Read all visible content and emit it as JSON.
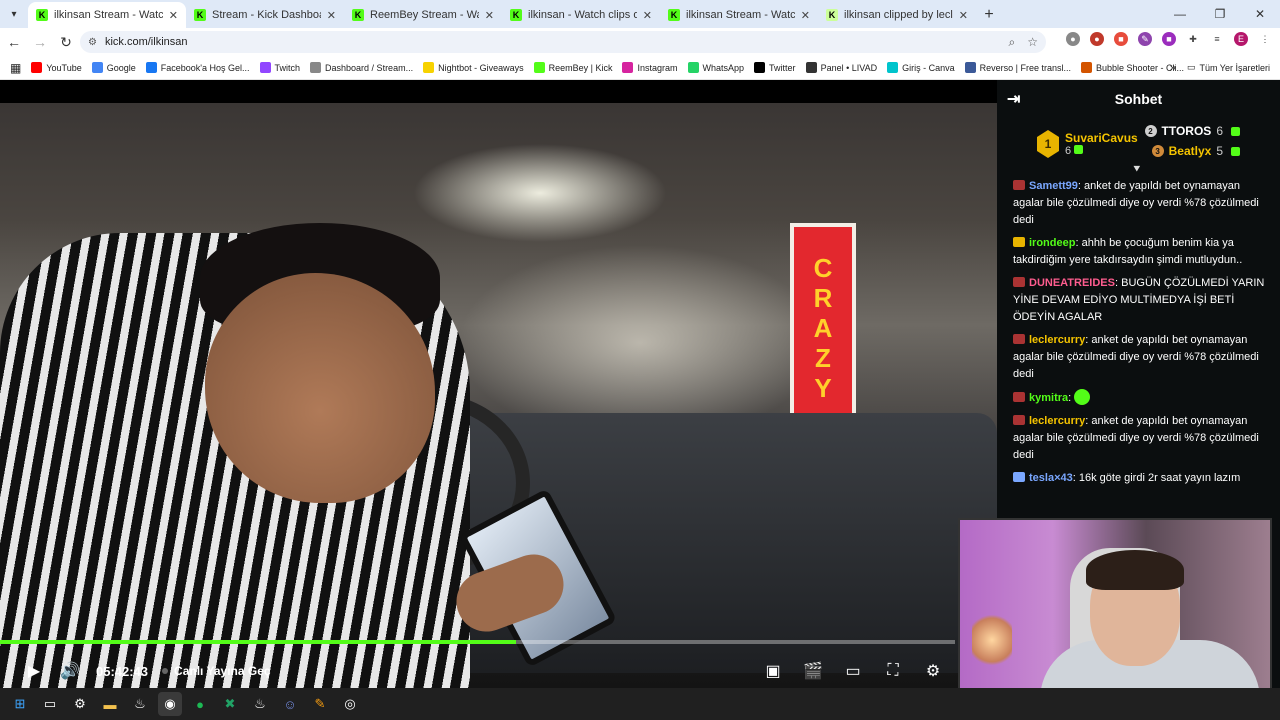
{
  "tabs": [
    {
      "title": "ilkinsan Stream - Watch Live on Kick",
      "active": true
    },
    {
      "title": "Stream - Kick Dashboard",
      "active": false
    },
    {
      "title": "ReemBey Stream - Watch Live on Kick",
      "active": false
    },
    {
      "title": "ilkinsan - Watch clips on Kick",
      "active": false
    },
    {
      "title": "ilkinsan Stream - Watch Live on Kick",
      "active": false
    },
    {
      "title": "ilkinsan clipped by leclercurry",
      "active": false
    }
  ],
  "address": {
    "url": "kick.com/ilkinsan"
  },
  "bookmarks": [
    "YouTube",
    "Google",
    "Facebook'a Hoş Gel...",
    "Twitch",
    "Dashboard / Stream...",
    "Nightbot - Giveaways",
    "ReemBey | Kick",
    "Instagram",
    "WhatsApp",
    "Twitter",
    "Panel • LIVAD",
    "Giriş - Canva",
    "Reverso | Free transl...",
    "Bubble Shooter - Cli..."
  ],
  "bookmarks_all": "Tüm Yer İşaretleri",
  "video": {
    "sign_text": [
      "C",
      "R",
      "A",
      "Z",
      "Y"
    ],
    "progress_fraction": 0.54,
    "time": "05:42:43",
    "live_label": "Canlı Yayına Geç"
  },
  "chat": {
    "title": "Sohbet",
    "leaders": {
      "first": {
        "rank": "1",
        "name": "SuvariCavus",
        "count": "6"
      },
      "second": {
        "rank": "2",
        "name": "TTOROS",
        "count": "6"
      },
      "third": {
        "rank": "3",
        "name": "Beatlyx",
        "count": "5"
      }
    },
    "messages": [
      {
        "user": "Samett99",
        "color": "#7aa7ff",
        "text": "anket de yapıldı bet oynamayan agalar bile çözülmedi diye oy verdi %78 çözülmedi dedi"
      },
      {
        "user": "irondeep",
        "color": "#53fc18",
        "text": "ahhh be çocuğum benim kia ya takdirdiğim yere takdırsaydın şimdi mutluydun.."
      },
      {
        "user": "DUNEATREIDES",
        "color": "#ff5d8f",
        "text": "BUGÜN ÇÖZÜLMEDİ YARIN YİNE DEVAM EDİYO MULTİMEDYA İŞİ BETİ ÖDEYİN AGALAR"
      },
      {
        "user": "leclercurry",
        "color": "#f5c400",
        "text": "anket de yapıldı bet oynamayan agalar bile çözülmedi diye oy verdi %78 çözülmedi dedi"
      },
      {
        "user": "kymitra",
        "color": "#53fc18",
        "text": ""
      },
      {
        "user": "leclercurry",
        "color": "#f5c400",
        "text": "anket de yapıldı bet oynamayan agalar bile çözülmedi diye oy verdi %78 çözülmedi dedi"
      },
      {
        "user": "tesla×43",
        "color": "#7aa7ff",
        "text": "16k göte girdi 2r saat yayın lazım"
      }
    ]
  }
}
